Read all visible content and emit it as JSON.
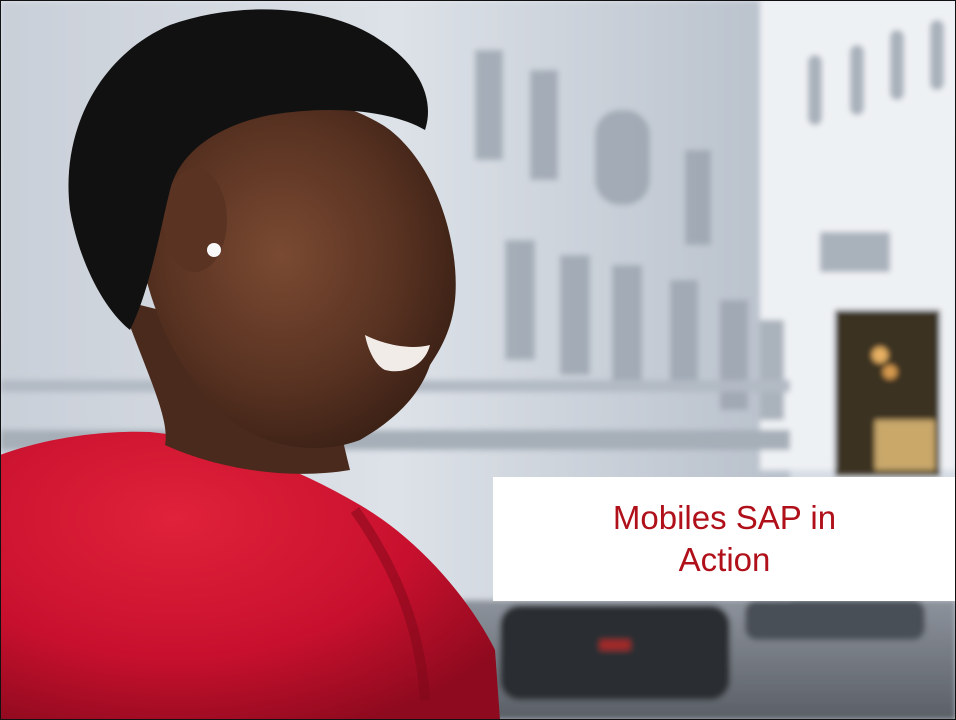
{
  "caption": {
    "line1": "Mobiles SAP in",
    "line2": "Action",
    "color": "#b0101a"
  },
  "photo": {
    "shirt_color": "#c8102e"
  }
}
